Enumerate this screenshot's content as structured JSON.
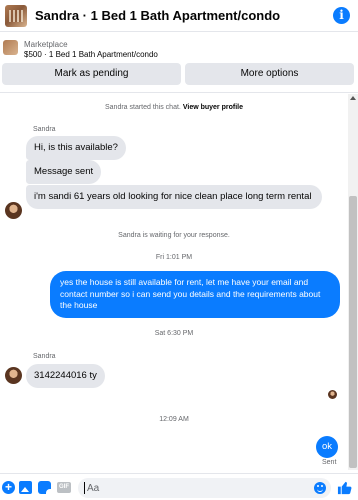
{
  "header": {
    "title": "Sandra · 1 Bed 1 Bath Apartment/condo",
    "info_glyph": "i",
    "icons": [
      "property-thumbnail-avatar",
      "info-icon"
    ]
  },
  "listing": {
    "source": "Marketplace",
    "price_title": "$500 · 1 Bed 1 Bath Apartment/condo"
  },
  "actions": {
    "mark_pending": "Mark as pending",
    "more_options": "More options"
  },
  "chat": {
    "started_text": "Sandra started this chat.",
    "view_profile": "View buyer profile",
    "sender_name_1": "Sandra",
    "incoming_1": "Hi, is this available?",
    "incoming_2": "Message sent",
    "incoming_3": "i'm sandi 61 years old looking for nice clean place long term rental",
    "waiting_text": "Sandra is waiting for your response.",
    "time_1": "Fri 1:01 PM",
    "outgoing_1": "yes the house is still available for rent, let me have your email  and contact number so i can send you details and the requirements about the house",
    "time_2": "Sat 6:30 PM",
    "sender_name_2": "Sandra",
    "incoming_4": "3142244016 ty",
    "time_3": "12:09 AM",
    "outgoing_2": "ok",
    "sent_status": "Sent"
  },
  "composer": {
    "placeholder": "Aa",
    "plus_glyph": "+",
    "gif_label": "GIF",
    "icons": [
      "plus-icon",
      "photo-icon",
      "sticker-icon",
      "gif-icon",
      "emoji-icon",
      "thumbs-up-icon"
    ]
  },
  "colors": {
    "accent": "#0a7cff",
    "incoming_bubble": "#e4e6eb",
    "secondary_text": "#65676b"
  }
}
